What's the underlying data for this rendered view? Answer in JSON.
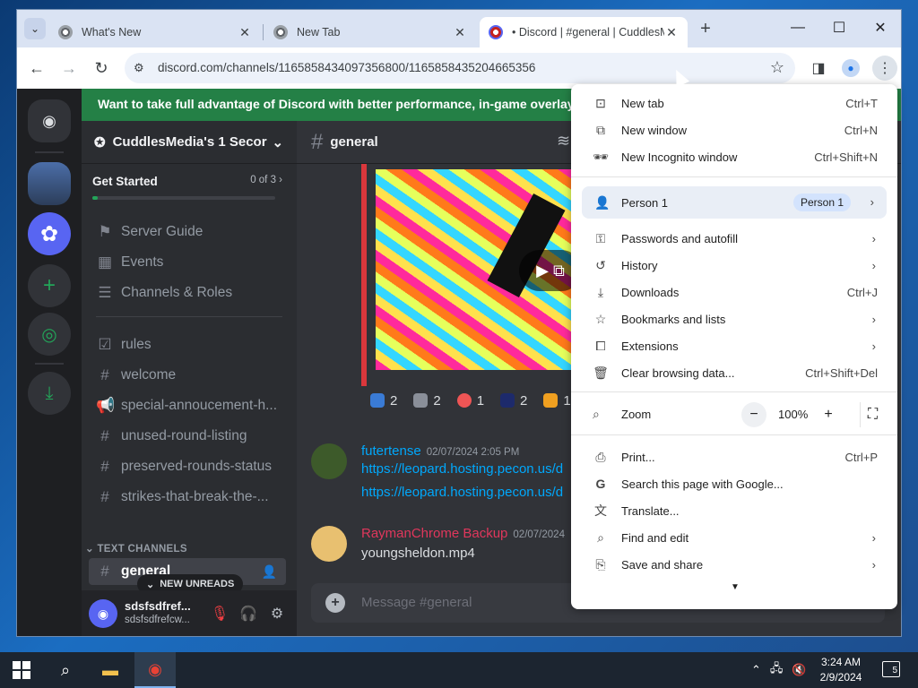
{
  "browser": {
    "tabs": [
      {
        "title": "What's New"
      },
      {
        "title": "New Tab"
      },
      {
        "title": "• Discord | #general | CuddlesM"
      }
    ],
    "url": "discord.com/channels/1165858434097356800/1165858435204665356"
  },
  "discord": {
    "banner": "Want to take full advantage of Discord with better performance, in-game overlay, and more",
    "server_name": "CuddlesMedia's 1 Secor",
    "get_started": {
      "title": "Get Started",
      "count": "0 of 3",
      "progress": 0
    },
    "nav_items": [
      {
        "label": "Server Guide",
        "icon": "signpost-icon"
      },
      {
        "label": "Events",
        "icon": "calendar-icon"
      },
      {
        "label": "Channels & Roles",
        "icon": "list-icon"
      }
    ],
    "channels": [
      {
        "label": "rules",
        "icon": "check-icon"
      },
      {
        "label": "welcome",
        "icon": "hash-icon"
      },
      {
        "label": "special-annoucement-h...",
        "icon": "megaphone-icon"
      },
      {
        "label": "unused-round-listing",
        "icon": "hash-icon"
      },
      {
        "label": "preserved-rounds-status",
        "icon": "hash-icon"
      },
      {
        "label": "strikes-that-break-the-...",
        "icon": "hash-icon"
      }
    ],
    "category": "TEXT CHANNELS",
    "active_channel": "general",
    "new_unreads": "NEW UNREADS",
    "user": {
      "name": "sdsfsdfref...",
      "status": "sdsfsdfrefcw..."
    },
    "chat_channel": "general",
    "reactions": [
      {
        "count": "2"
      },
      {
        "count": "2"
      },
      {
        "count": "1"
      },
      {
        "count": "2"
      },
      {
        "count": "1"
      }
    ],
    "messages": [
      {
        "author": "futertense",
        "time": "02/07/2024 2:05 PM",
        "color": "#00a8fc",
        "lines": [
          "https://leopard.hosting.pecon.us/d",
          "https://leopard.hosting.pecon.us/d"
        ]
      },
      {
        "author": "RaymanChrome Backup",
        "time": "02/07/2024",
        "color": "#e0375c",
        "lines": [
          "youngsheldon.mp4"
        ]
      }
    ],
    "composer_placeholder": "Message #general"
  },
  "menu": {
    "items_top": [
      {
        "label": "New tab",
        "shortcut": "Ctrl+T",
        "icon": "new-tab-icon"
      },
      {
        "label": "New window",
        "shortcut": "Ctrl+N",
        "icon": "new-window-icon"
      },
      {
        "label": "New Incognito window",
        "shortcut": "Ctrl+Shift+N",
        "icon": "incognito-icon"
      }
    ],
    "person": {
      "label": "Person 1",
      "badge": "Person 1"
    },
    "items_mid": [
      {
        "label": "Passwords and autofill",
        "icon": "key-icon",
        "submenu": true
      },
      {
        "label": "History",
        "icon": "history-icon",
        "submenu": true
      },
      {
        "label": "Downloads",
        "shortcut": "Ctrl+J",
        "icon": "download-icon"
      },
      {
        "label": "Bookmarks and lists",
        "icon": "star-icon",
        "submenu": true
      },
      {
        "label": "Extensions",
        "icon": "puzzle-icon",
        "submenu": true
      },
      {
        "label": "Clear browsing data...",
        "shortcut": "Ctrl+Shift+Del",
        "icon": "trash-icon"
      }
    ],
    "zoom": {
      "label": "Zoom",
      "value": "100%"
    },
    "items_bottom": [
      {
        "label": "Print...",
        "shortcut": "Ctrl+P",
        "icon": "print-icon"
      },
      {
        "label": "Search this page with Google...",
        "icon": "google-icon"
      },
      {
        "label": "Translate...",
        "icon": "translate-icon"
      },
      {
        "label": "Find and edit",
        "icon": "find-icon",
        "submenu": true
      },
      {
        "label": "Save and share",
        "icon": "share-icon",
        "submenu": true
      }
    ]
  },
  "taskbar": {
    "time": "3:24 AM",
    "date": "2/9/2024",
    "notifications": "5"
  }
}
